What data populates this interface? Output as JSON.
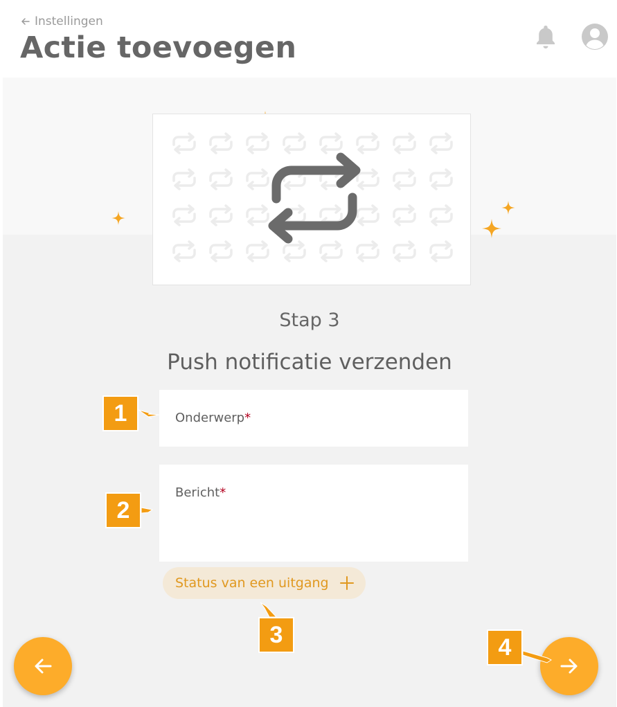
{
  "header": {
    "back_label": "Instellingen",
    "title": "Actie toevoegen"
  },
  "step": {
    "label": "Stap 3",
    "title": "Push notificatie verzenden"
  },
  "form": {
    "subject_label": "Onderwerp",
    "message_label": "Bericht",
    "required_mark": "*",
    "add_chip_label": "Status van een uitgang"
  },
  "callouts": [
    "1",
    "2",
    "3",
    "4"
  ],
  "icons": {
    "back": "arrow-left-icon",
    "bell": "bell-icon",
    "avatar": "user-avatar-icon",
    "illustration": "repeat-arrows-icon",
    "add": "plus-icon",
    "prev": "arrow-left-icon",
    "next": "arrow-right-icon"
  },
  "colors": {
    "accent": "#fdac2a",
    "callout": "#f39c12",
    "required": "#b3001e",
    "chip_bg": "#f4e9d7",
    "chip_text": "#e0981f"
  }
}
